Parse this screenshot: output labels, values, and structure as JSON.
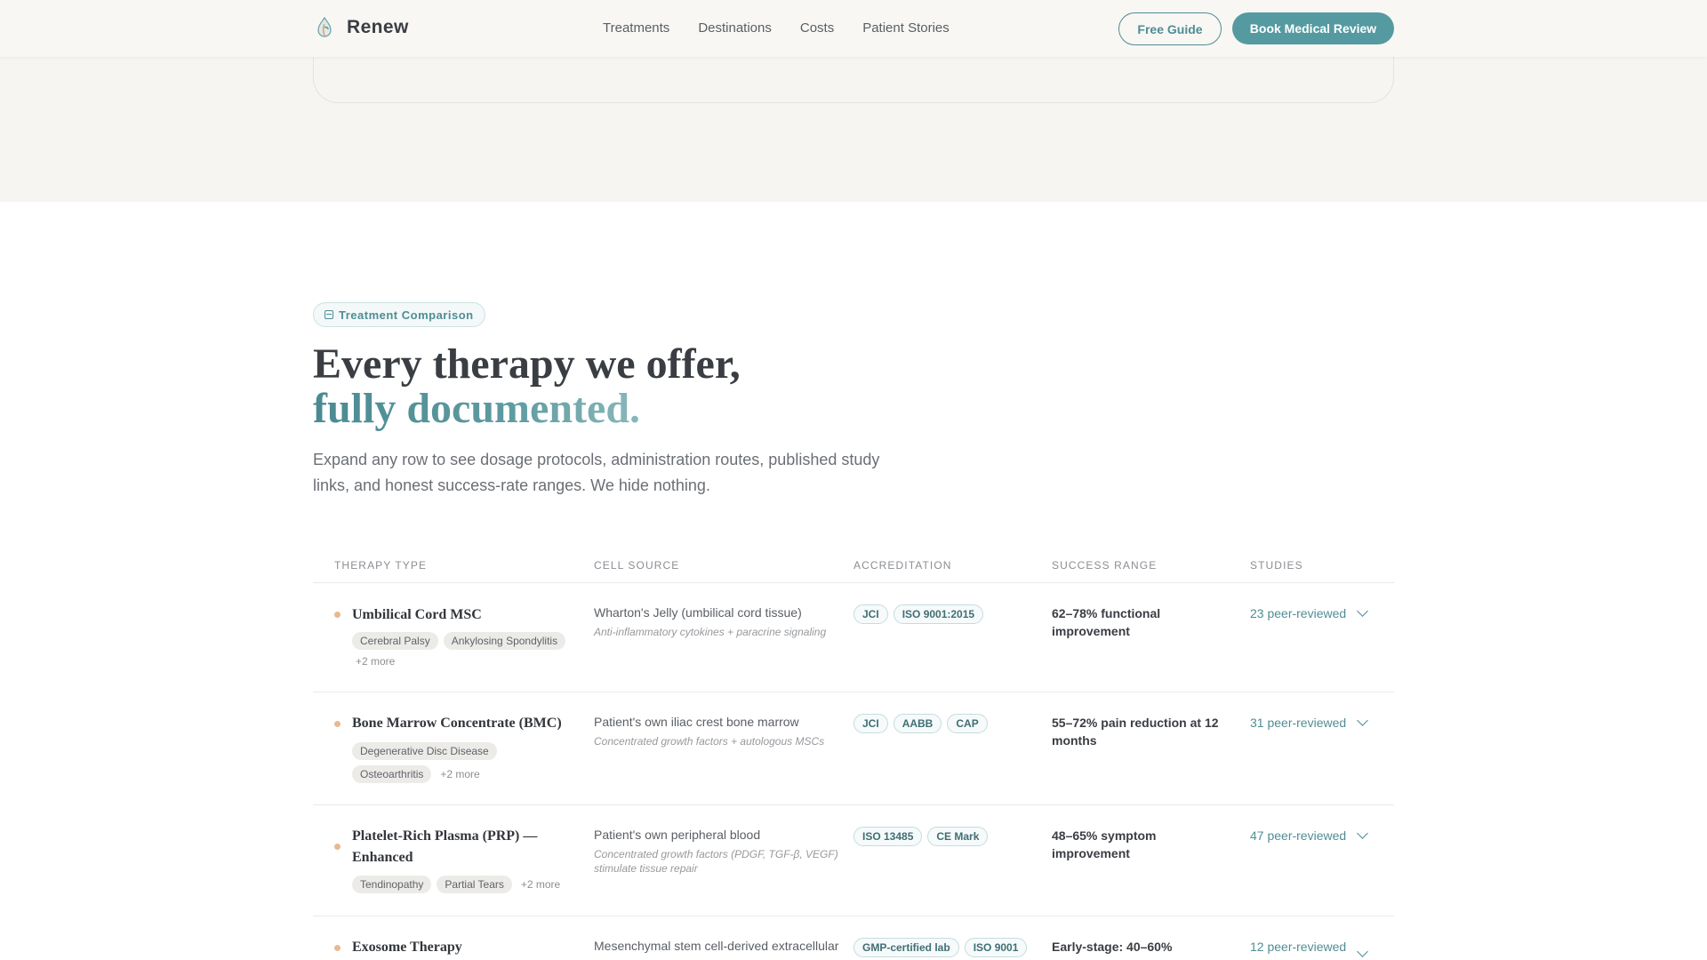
{
  "brand": {
    "name": "Renew",
    "logo_icon": "droplet-leaf-icon",
    "accent": "#559aa0"
  },
  "nav": [
    {
      "label": "Treatments"
    },
    {
      "label": "Destinations"
    },
    {
      "label": "Costs"
    },
    {
      "label": "Patient Stories"
    }
  ],
  "header": {
    "guide_label": "Free Guide",
    "book_label": "Book Medical Review"
  },
  "section": {
    "eyebrow": "Treatment Comparison",
    "title_line1": "Every therapy we offer,",
    "title_line2": "fully documented.",
    "lead": "Expand any row to see dosage protocols, administration routes, published study links, and honest success-rate ranges. We hide nothing."
  },
  "table": {
    "columns": [
      "THERAPY TYPE",
      "CELL SOURCE",
      "ACCREDITATION",
      "SUCCESS RANGE",
      "STUDIES"
    ],
    "rows": [
      {
        "name": "Umbilical Cord MSC",
        "tags": [
          "Cerebral Palsy",
          "Ankylosing Spondylitis"
        ],
        "more": "+2 more",
        "source": "Wharton's Jelly (umbilical cord tissue)",
        "mechanism": "Anti-inflammatory cytokines + paracrine signaling",
        "accreditations": [
          "JCI",
          "ISO 9001:2015"
        ],
        "success": "62–78% functional improvement",
        "studies": "23 peer-reviewed"
      },
      {
        "name": "Bone Marrow Concentrate (BMC)",
        "tags": [
          "Degenerative Disc Disease",
          "Osteoarthritis"
        ],
        "more": "+2 more",
        "source": "Patient's own iliac crest bone marrow",
        "mechanism": "Concentrated growth factors + autologous MSCs",
        "accreditations": [
          "JCI",
          "AABB",
          "CAP"
        ],
        "success": "55–72% pain reduction at 12 months",
        "studies": "31 peer-reviewed"
      },
      {
        "name": "Platelet-Rich Plasma (PRP) — Enhanced",
        "tags": [
          "Tendinopathy",
          "Partial Tears"
        ],
        "more": "+2 more",
        "source": "Patient's own peripheral blood",
        "mechanism": "Concentrated growth factors (PDGF, TGF-β, VEGF) stimulate tissue repair",
        "accreditations": [
          "ISO 13485",
          "CE Mark"
        ],
        "success": "48–65% symptom improvement",
        "studies": "47 peer-reviewed"
      },
      {
        "name": "Exosome Therapy",
        "tags": [],
        "more": "",
        "source": "Mesenchymal stem cell-derived extracellular",
        "mechanism": "",
        "accreditations": [
          "GMP-certified lab",
          "ISO 9001"
        ],
        "success": "Early-stage: 40–60%",
        "studies": "12 peer-reviewed"
      }
    ]
  }
}
